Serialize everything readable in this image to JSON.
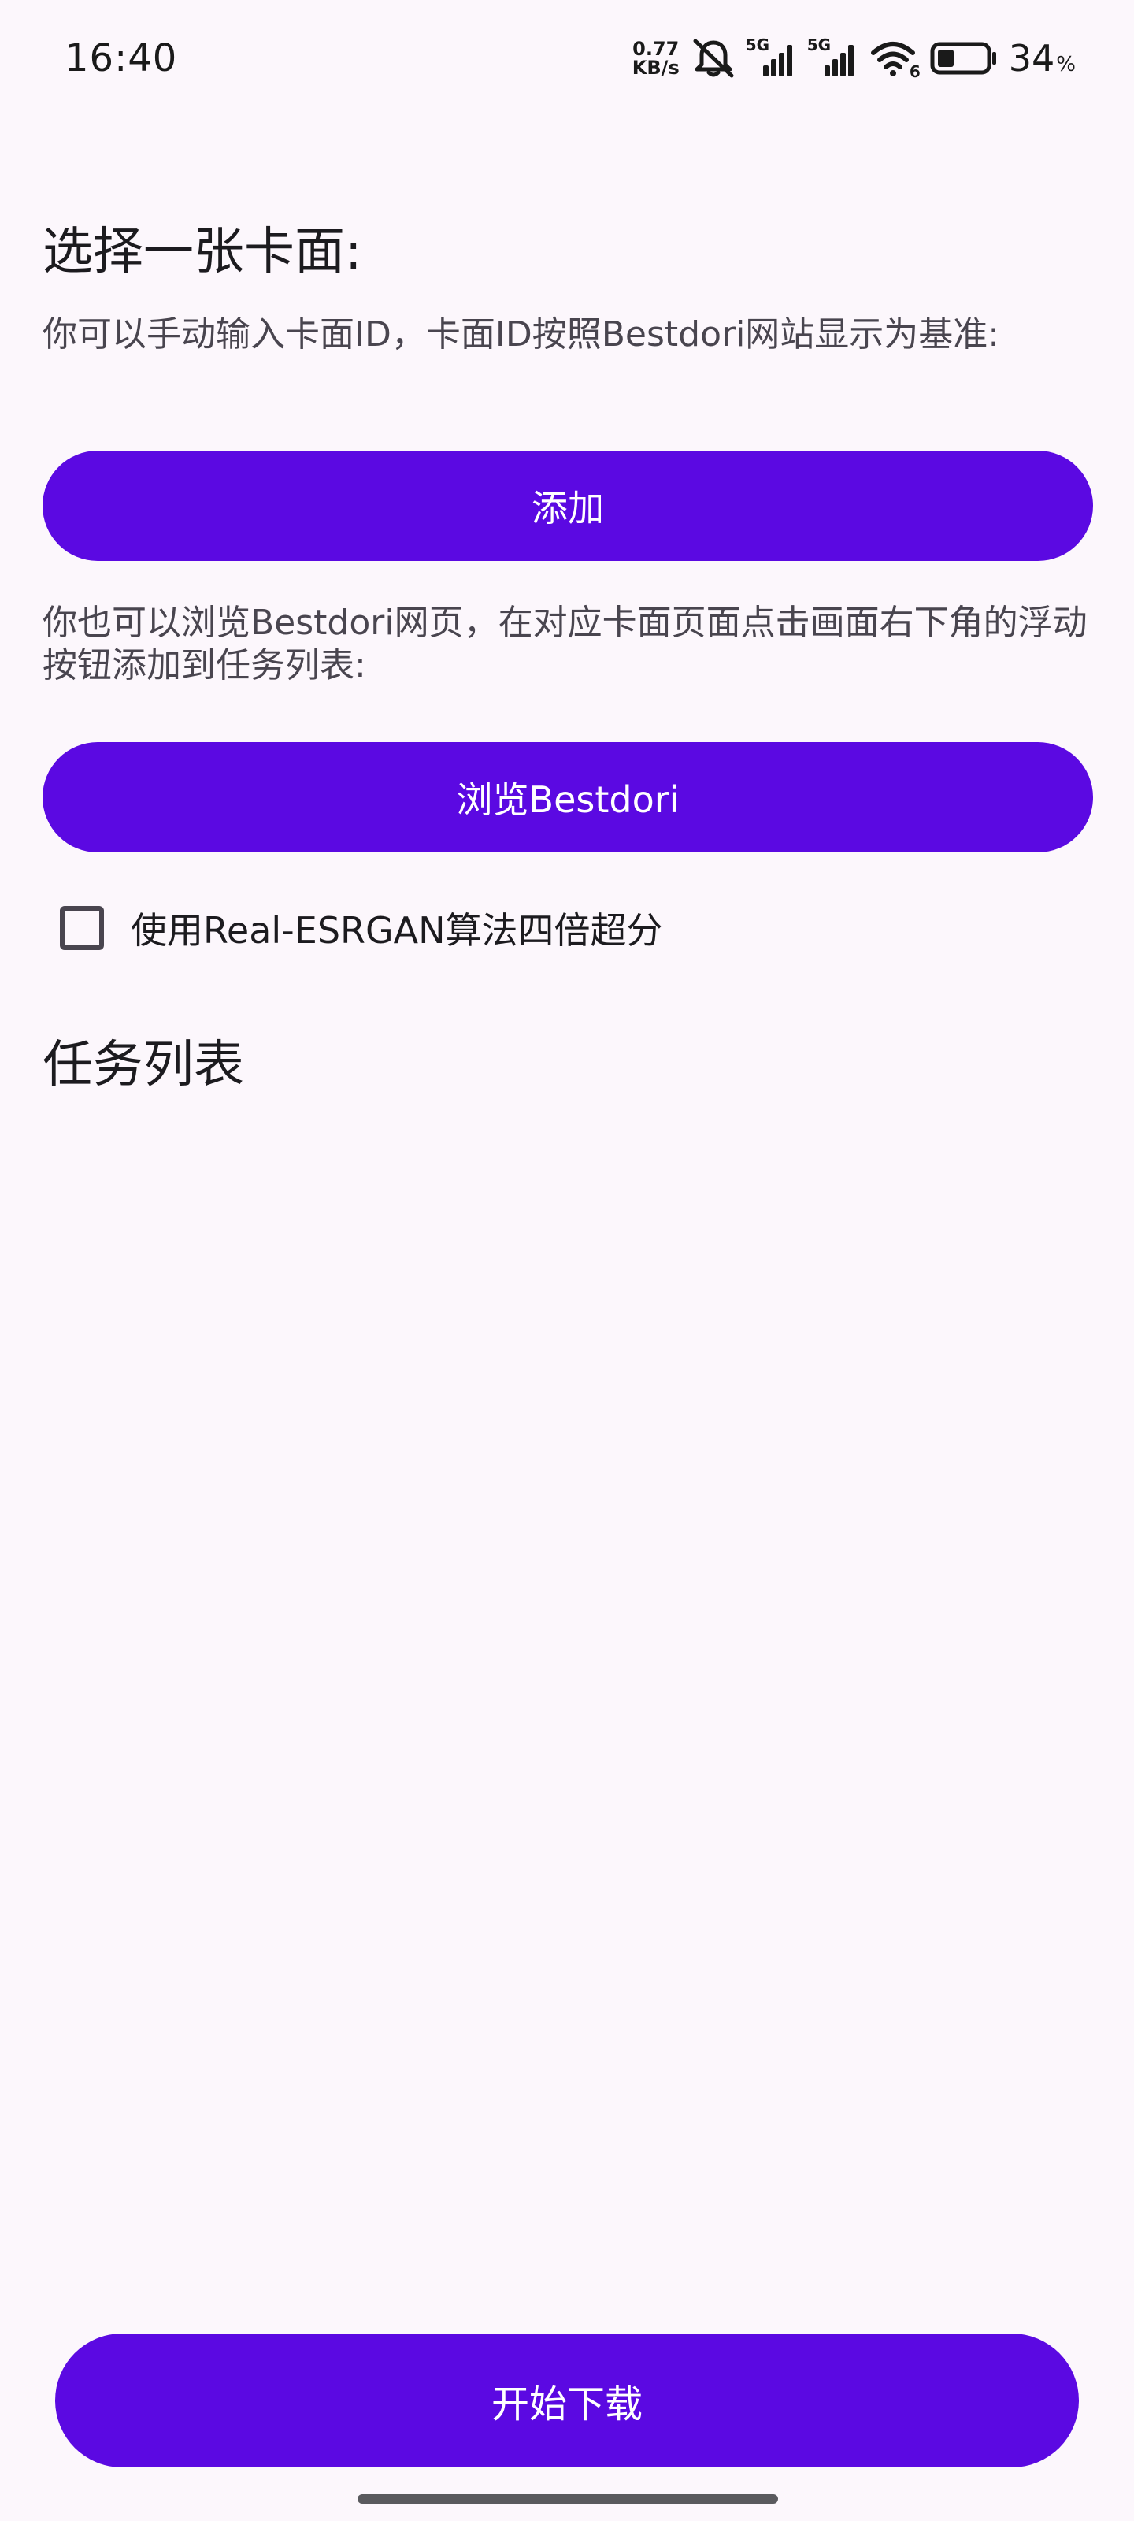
{
  "status_bar": {
    "time": "16:40",
    "net_speed_value": "0.77",
    "net_speed_unit": "KB/s",
    "signal_1_label": "5G",
    "signal_2_label": "5G",
    "wifi_badge": "6",
    "battery_level": 34,
    "battery_text": "34",
    "battery_unit": "%",
    "icons": [
      "mute-icon",
      "signal-icon",
      "signal-icon",
      "wifi-icon",
      "battery-icon"
    ]
  },
  "main": {
    "choose_title": "选择一张卡面:",
    "manual_desc": "你可以手动输入卡面ID，卡面ID按照Bestdori网站显示为基准:",
    "add_button": "添加",
    "browse_desc": "你也可以浏览Bestdori网页，在对应卡面页面点击画面右下角的浮动按钮添加到任务列表:",
    "browse_button": "浏览Bestdori",
    "upscale_checkbox": {
      "label": "使用Real-ESRGAN算法四倍超分",
      "checked": false
    },
    "tasks_title": "任务列表",
    "tasks": []
  },
  "footer": {
    "download_button": "开始下载"
  },
  "colors": {
    "primary": "#5b09e2",
    "background": "#fcf7fc",
    "on_primary": "#ffffff",
    "text": "#1c1b1f",
    "secondary_text": "#49454f"
  }
}
